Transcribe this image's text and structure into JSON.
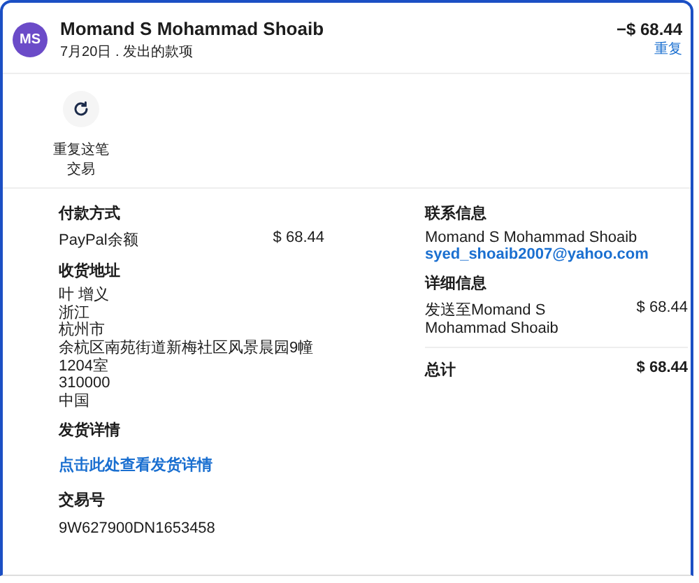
{
  "header": {
    "avatar": "MS",
    "name": "Momand S Mohammad Shoaib",
    "subtitle": "7月20日 . 发出的款项",
    "amount": "−$ 68.44",
    "repeat_link": "重复"
  },
  "actions": [
    {
      "kind": "repeat",
      "label": "重复这笔交易"
    }
  ],
  "payment": {
    "title": "付款方式",
    "method": "PayPal余额",
    "amount": "$ 68.44"
  },
  "shipping_address": {
    "title": "收货地址",
    "lines": [
      "叶 增义",
      "浙江",
      "杭州市",
      "余杭区南苑街道新梅社区风景晨园9幢1204室",
      "310000",
      "中国"
    ]
  },
  "shipping_details": {
    "title": "发货详情",
    "link": "点击此处查看发货详情"
  },
  "transaction": {
    "title": "交易号",
    "id": "9W627900DN1653458"
  },
  "contact": {
    "title": "联系信息",
    "name": "Momand S Mohammad Shoaib",
    "email": "syed_shoaib2007@yahoo.com"
  },
  "details": {
    "title": "详细信息",
    "rows": [
      {
        "label": "发送至Momand S Mohammad Shoaib",
        "amount": "$ 68.44"
      }
    ]
  },
  "total": {
    "label": "总计",
    "amount": "$ 68.44"
  }
}
